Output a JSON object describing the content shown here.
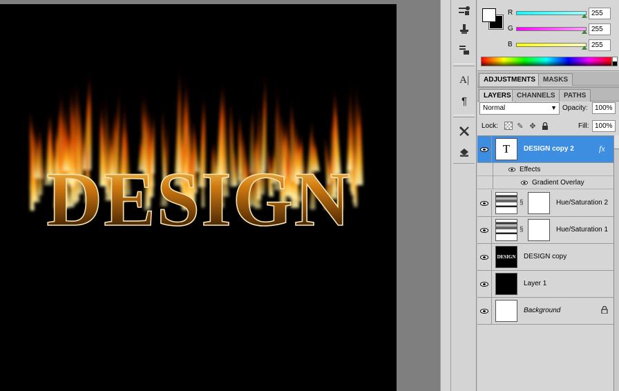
{
  "canvas": {
    "artwork_text": "DESIGN"
  },
  "color_panel": {
    "channels": [
      {
        "label": "R",
        "value": "255",
        "color": "#00d8e8"
      },
      {
        "label": "G",
        "value": "255",
        "color": "#e020e0"
      },
      {
        "label": "B",
        "value": "255",
        "color": "#e8e000"
      }
    ]
  },
  "tabs_top": [
    {
      "label": "ADJUSTMENTS"
    },
    {
      "label": "MASKS"
    }
  ],
  "tabs_layers": [
    {
      "label": "LAYERS"
    },
    {
      "label": "CHANNELS"
    },
    {
      "label": "PATHS"
    }
  ],
  "layers_panel": {
    "blend_mode": "Normal",
    "opacity_label": "Opacity:",
    "opacity": "100%",
    "lock_label": "Lock:",
    "fill_label": "Fill:",
    "fill": "100%"
  },
  "layers": [
    {
      "name": "DESIGN copy 2",
      "thumb_text": "T",
      "fx": "fx",
      "selected": true
    },
    {
      "effects_label": "Effects",
      "effect": "Gradient Overlay"
    },
    {
      "name": "Hue/Saturation 2"
    },
    {
      "name": "Hue/Saturation 1"
    },
    {
      "name": "DESIGN copy",
      "thumb_text": "DESIGN"
    },
    {
      "name": "Layer 1"
    },
    {
      "name": "Background"
    }
  ],
  "icons": {
    "dock": [
      "brush-presets-icon",
      "clone-source-icon",
      "tool-presets-icon",
      "character-icon",
      "paragraph-icon",
      "tools-icon",
      "actions-icon"
    ],
    "lock": [
      "lock-transparent-icon",
      "lock-image-icon",
      "lock-position-icon",
      "lock-all-icon"
    ]
  }
}
